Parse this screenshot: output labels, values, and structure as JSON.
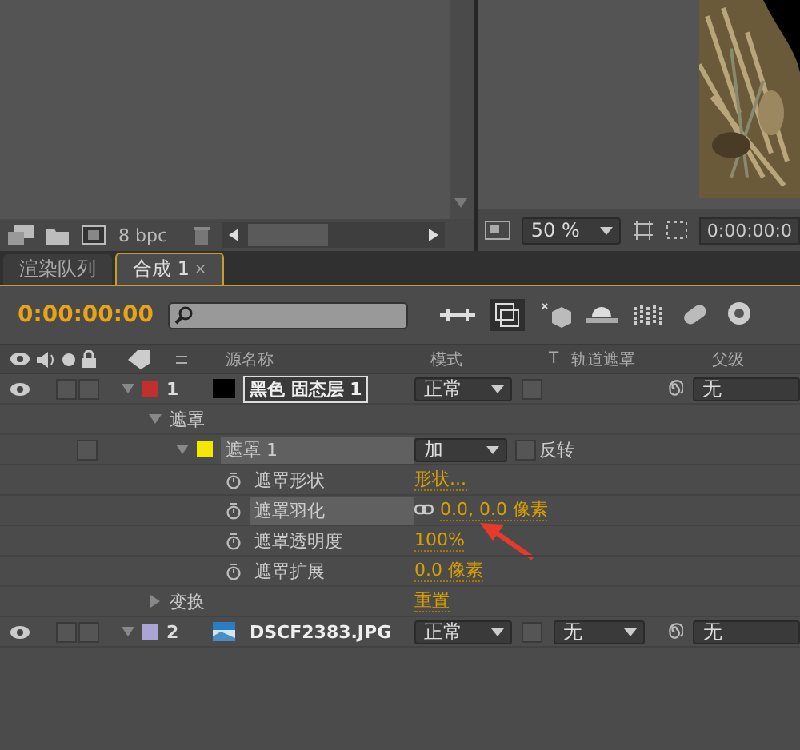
{
  "project_panel": {
    "bit_depth": "8 bpc"
  },
  "viewer": {
    "zoom": "50 %",
    "timecode": "0:00:00:0"
  },
  "tabs": [
    {
      "label": "渲染队列",
      "selected": false
    },
    {
      "label": "合成 1",
      "selected": true,
      "close": "×"
    }
  ],
  "timeline": {
    "timecode": "0:00:00:00",
    "columns": [
      "源名称",
      "模式",
      "T",
      "轨道遮罩",
      "父级"
    ],
    "layers": [
      {
        "kind": "solid_layer",
        "visible": true,
        "solo": false,
        "locked": false,
        "preserve_transparency": false,
        "number": "1",
        "name": "黑色 固态层 1",
        "color": "#c0302c",
        "selected": true,
        "expanded": true,
        "mode": "正常",
        "parent": "无",
        "children": [
          {
            "kind": "group",
            "label": "遮罩",
            "expanded": true,
            "children": [
              {
                "kind": "mask",
                "locked": false,
                "label": "遮罩 1",
                "color": "#f4e800",
                "selected": true,
                "expanded": true,
                "mode": "加",
                "invert_label": "反转",
                "inverted": false,
                "children": [
                  {
                    "kind": "property",
                    "label": "遮罩形状",
                    "value": "形状...",
                    "linked": false,
                    "selected": false
                  },
                  {
                    "kind": "property",
                    "label": "遮罩羽化",
                    "value": "0.0, 0.0 像素",
                    "linked": true,
                    "selected": true
                  },
                  {
                    "kind": "property",
                    "label": "遮罩透明度",
                    "value": "100%",
                    "linked": false,
                    "selected": false
                  },
                  {
                    "kind": "property",
                    "label": "遮罩扩展",
                    "value": "0.0 像素",
                    "linked": false,
                    "selected": false
                  }
                ]
              }
            ]
          },
          {
            "kind": "group",
            "label": "变换",
            "expanded": false,
            "value": "重置"
          }
        ]
      },
      {
        "kind": "footage_layer",
        "visible": true,
        "solo": false,
        "locked": false,
        "preserve_transparency": false,
        "number": "2",
        "name": "DSCF2383.JPG",
        "color": "#a9a6d6",
        "selected": false,
        "expanded": true,
        "mode": "正常",
        "track_matte": "无",
        "parent": "无"
      }
    ]
  }
}
